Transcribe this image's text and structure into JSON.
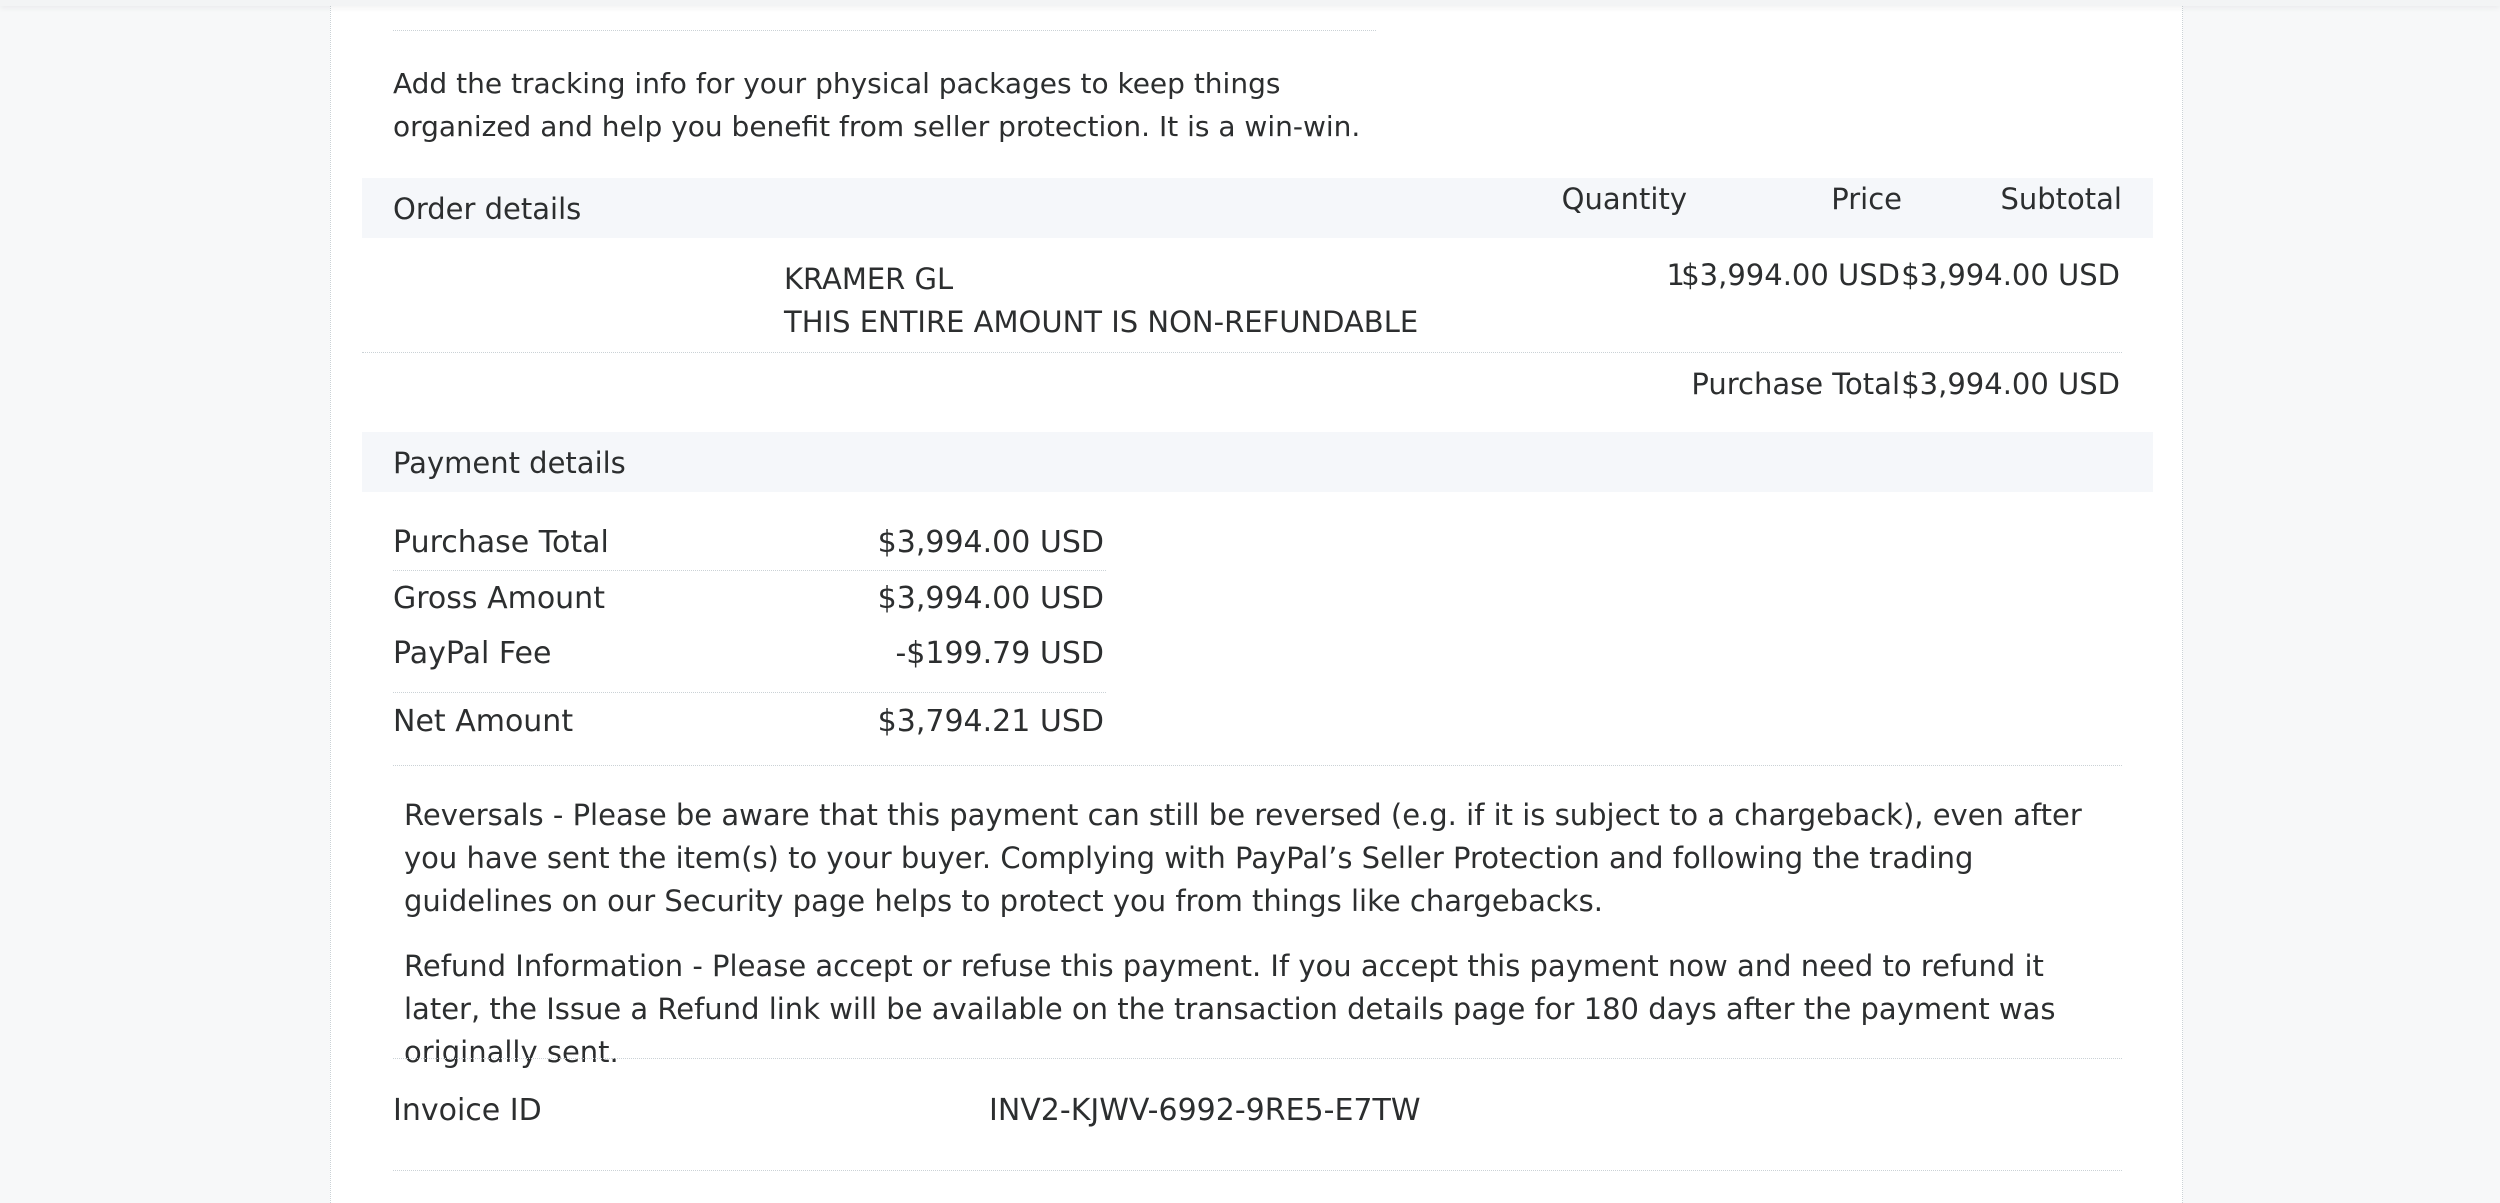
{
  "intro": {
    "line1": "Add the tracking info for your physical packages to keep things",
    "line2": "organized and help you benefit from seller protection. It is a win-win."
  },
  "order": {
    "heading": "Order details",
    "columns": {
      "quantity": "Quantity",
      "price": "Price",
      "subtotal": "Subtotal"
    },
    "item": {
      "name": "KRAMER GL",
      "description": "THIS ENTIRE AMOUNT IS NON-REFUNDABLE",
      "quantity": "1",
      "price": "$3,994.00 USD",
      "subtotal": "$3,994.00 USD"
    },
    "purchase_total_label": "Purchase Total",
    "purchase_total_value": "$3,994.00 USD"
  },
  "payment": {
    "heading": "Payment details",
    "rows": [
      {
        "label": "Purchase Total",
        "value": "$3,994.00 USD"
      },
      {
        "label": "Gross Amount",
        "value": "$3,994.00 USD"
      },
      {
        "label": "PayPal Fee",
        "value": "-$199.79 USD"
      },
      {
        "label": "Net Amount",
        "value": "$3,794.21 USD"
      }
    ]
  },
  "notices": {
    "reversals": "Reversals - Please be aware that this payment can still be reversed (e.g. if it is subject to a chargeback), even after you have sent the item(s) to your buyer. Complying with PayPal’s Seller Protection and following the trading guidelines on our Security page helps to protect you from things like chargebacks.",
    "refund": "Refund Information - Please accept or refuse this payment. If you accept this payment now and need to refund it later, the Issue a Refund link will be available on the transaction details page for 180 days after the payment was originally sent."
  },
  "invoice": {
    "label": "Invoice ID",
    "value": "INV2-KJWV-6992-9RE5-E7TW"
  }
}
